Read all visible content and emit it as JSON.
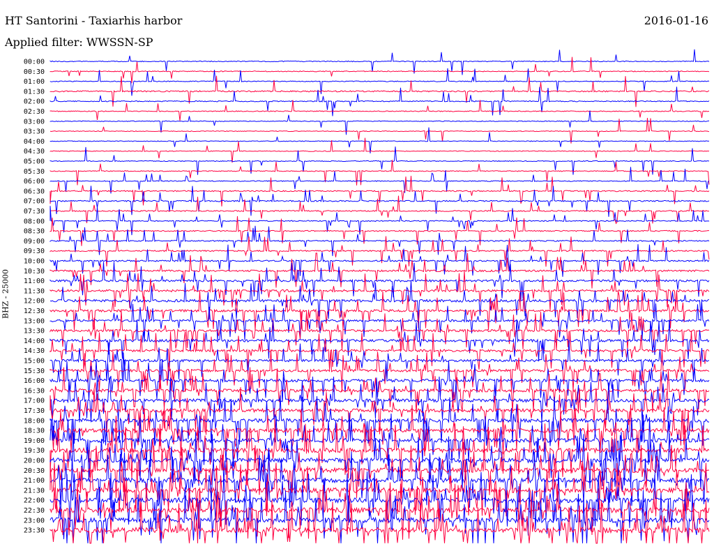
{
  "header": {
    "title": "HT Santorini - Taxiarhis harbor",
    "date": "2016-01-16",
    "filter_label": "Applied filter: WWSSN-SP"
  },
  "chart_data": {
    "type": "line",
    "ylabel": "BHZ - 25000",
    "y_tick_labels": [
      "00:00",
      "00:30",
      "01:00",
      "01:30",
      "02:00",
      "02:30",
      "03:00",
      "03:30",
      "04:00",
      "04:30",
      "05:00",
      "05:30",
      "06:00",
      "06:30",
      "07:00",
      "07:30",
      "08:00",
      "08:30",
      "09:00",
      "09:30",
      "10:00",
      "10:30",
      "11:00",
      "11:30",
      "12:00",
      "12:30",
      "13:00",
      "13:30",
      "14:00",
      "14:30",
      "15:00",
      "15:30",
      "16:00",
      "16:30",
      "17:00",
      "17:30",
      "18:00",
      "18:30",
      "19:00",
      "19:30",
      "20:00",
      "20:30",
      "21:00",
      "21:30",
      "22:00",
      "22:30",
      "23:00",
      "23:30"
    ],
    "trace_colors": [
      "#0000ff",
      "#ff0040"
    ],
    "noise_level": [
      0.6,
      0.6,
      0.6,
      0.9,
      0.7,
      0.6,
      0.5,
      0.5,
      0.5,
      0.5,
      0.6,
      0.6,
      0.6,
      0.8,
      0.9,
      0.8,
      0.7,
      0.8,
      0.8,
      0.9,
      1.0,
      1.2,
      1.4,
      1.6,
      1.8,
      1.6,
      1.5,
      1.6,
      1.8,
      1.6,
      1.7,
      1.8,
      2.0,
      2.2,
      2.3,
      2.4,
      2.6,
      2.8,
      3.0,
      3.1,
      3.2,
      3.2,
      3.3,
      3.4,
      3.4,
      3.5,
      3.5,
      3.6
    ],
    "spike_density": [
      0.02,
      0.02,
      0.02,
      0.03,
      0.03,
      0.02,
      0.02,
      0.02,
      0.02,
      0.02,
      0.02,
      0.02,
      0.03,
      0.04,
      0.05,
      0.05,
      0.05,
      0.05,
      0.05,
      0.06,
      0.06,
      0.07,
      0.08,
      0.08,
      0.09,
      0.09,
      0.09,
      0.09,
      0.1,
      0.1,
      0.1,
      0.1,
      0.11,
      0.11,
      0.12,
      0.12,
      0.13,
      0.13,
      0.14,
      0.14,
      0.15,
      0.15,
      0.15,
      0.16,
      0.16,
      0.16,
      0.17,
      0.17
    ]
  }
}
